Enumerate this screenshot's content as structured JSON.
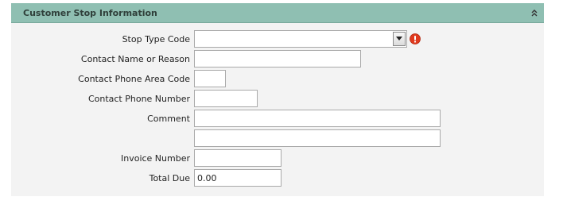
{
  "panel": {
    "title": "Customer Stop Information",
    "collapse_icon": "double-chevron-up-icon"
  },
  "form": {
    "stop_type_code": {
      "label": "Stop Type Code",
      "value": "",
      "error_icon": "error-exclamation-icon",
      "error_color": "#e03a1e"
    },
    "contact_name": {
      "label": "Contact Name or Reason",
      "value": ""
    },
    "phone_area_code": {
      "label": "Contact Phone Area Code",
      "value": ""
    },
    "phone_number": {
      "label": "Contact Phone Number",
      "value": ""
    },
    "comment": {
      "label": "Comment",
      "value": "",
      "value2": ""
    },
    "invoice_number": {
      "label": "Invoice Number",
      "value": ""
    },
    "total_due": {
      "label": "Total Due",
      "value": "0.00"
    }
  },
  "colors": {
    "header_bg": "#8fbfb2",
    "panel_bg": "#f3f3f3"
  }
}
